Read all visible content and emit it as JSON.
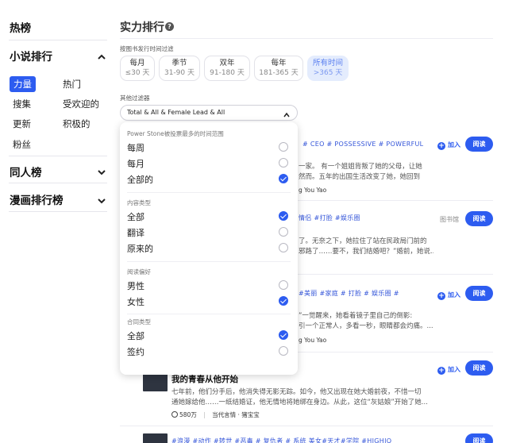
{
  "sidebar": {
    "hot_title": "热榜",
    "novel_title": "小说排行",
    "novel_items": [
      "力量",
      "热门",
      "搜集",
      "受欢迎的",
      "更新",
      "积极的",
      "粉丝"
    ],
    "fan_title": "同人榜",
    "comic_title": "漫画排行榜"
  },
  "main": {
    "title": "实力排行",
    "time_filter_label": "按图书发行时间过滤",
    "time_filters": [
      {
        "label": "每月",
        "sub": "≤30 天"
      },
      {
        "label": "季节",
        "sub": "31-90 天"
      },
      {
        "label": "双年",
        "sub": "91-180 天"
      },
      {
        "label": "每年",
        "sub": "181-365 天"
      },
      {
        "label": "所有时间",
        "sub": ">365 天"
      }
    ],
    "selected_time_filter": "所有时间",
    "other_filter_label": "其他过滤器",
    "select_value": "Total & All & Female Lead & All"
  },
  "dropdown": {
    "group1_title": "Power Stone被投票最多的时间范围",
    "group1": [
      "每周",
      "每月",
      "全部的"
    ],
    "group1_checked": "全部的",
    "group2_title": "内容类型",
    "group2": [
      "全部",
      "翻译",
      "原来的"
    ],
    "group2_checked": "全部",
    "group3_title": "阅读偏好",
    "group3": [
      "男性",
      "女性"
    ],
    "group3_checked": "女性",
    "group4_title": "合同类型",
    "group4": [
      "全部",
      "签约"
    ],
    "group4_checked": "全部"
  },
  "books": [
    {
      "tags": "# CEO   # POSSESSIVE   # POWERFUL",
      "desc1": "一家。 有一个姐姐背叛了她的父母，让她",
      "desc2": "然而。五年的出国生活改变了她，她回到",
      "author": "g You Yao",
      "add": "加入",
      "read": "阅读"
    },
    {
      "tags": "情侣 #打脸 #娱乐圈",
      "desc1": "了。无奈之下，她拉住了站在民政局门前的",
      "desc2": "邪路了……要不，我们结婚吧？”婚前，她说...",
      "lib": "图书馆",
      "read": "阅读"
    },
    {
      "tags": "#美丽   #家庭   # 打脸 # 娱乐圈   #",
      "desc1": "”一觉醒来，她看着镜子里自己的倒影:",
      "desc2": "引一个正常人，多看一秒，眼睛都会灼痛。...",
      "author": "g You Yao",
      "add": "加入",
      "read": "阅读"
    },
    {
      "title": "我的青春从他开始",
      "desc1": "七年前，他们分手后，他消失得无影无踪。如今，他又出现在她大婚前夜，不惜一切",
      "desc2": "通她嫁给他……一纸结婚证，他无情地将她绑在身边。从此，这位“灰姑娘”开始了她...",
      "stats": "580万",
      "author_line": "当代言情 · 猪宝宝",
      "add": "加入",
      "read": "阅读"
    },
    {
      "tags": "#浪漫   #动作   #转世   #恶毒   # 复仇者 #   系统   美女#天才#学院   #HIGHIQ",
      "read": "阅读"
    }
  ],
  "colors": {
    "accent": "#2d5cf0",
    "selected_bg": "#e4ecfd"
  },
  "icons": [
    "help-icon",
    "chevron-up-icon",
    "chevron-down-icon",
    "plus-icon",
    "fire-icon"
  ]
}
